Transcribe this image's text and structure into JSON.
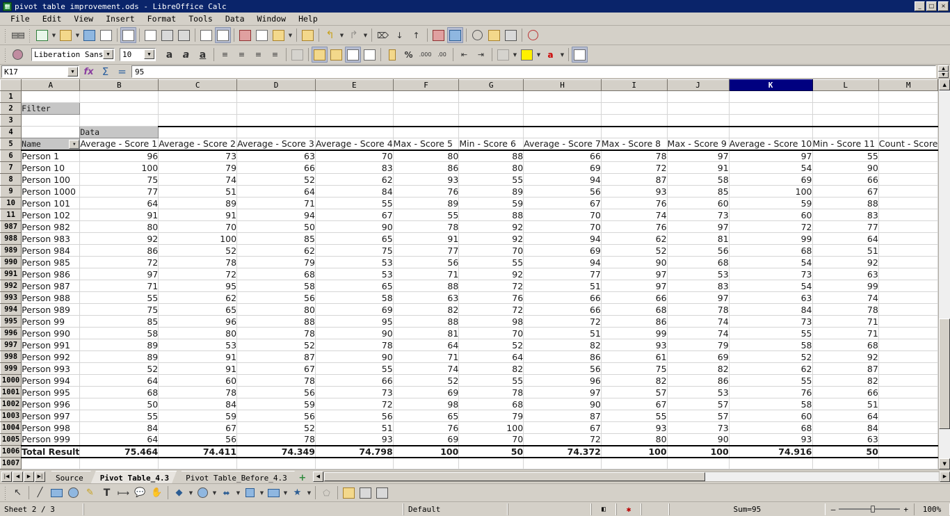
{
  "window": {
    "title": "pivot table improvement.ods - LibreOffice Calc",
    "minimize": "_",
    "maximize": "□",
    "close": "×"
  },
  "menu": [
    "File",
    "Edit",
    "View",
    "Insert",
    "Format",
    "Tools",
    "Data",
    "Window",
    "Help"
  ],
  "formatting": {
    "font_name": "Liberation Sans",
    "font_size": "10"
  },
  "formula_bar": {
    "name_box": "K17",
    "content": "95",
    "function_wizard": "fx",
    "sum": "Σ",
    "formula": "="
  },
  "sheet": {
    "columns": [
      "A",
      "B",
      "C",
      "D",
      "E",
      "F",
      "G",
      "H",
      "I",
      "J",
      "K",
      "L",
      "M"
    ],
    "selected_column": "K",
    "labels": {
      "filter": "Filter",
      "data": "Data",
      "name": "Name",
      "total_result": "Total Result"
    },
    "headers": [
      "Average - Score 1",
      "Average - Score 2",
      "Average - Score 3",
      "Average - Score 4",
      "Max - Score 5",
      "Min - Score 6",
      "Average - Score 7",
      "Max - Score 8",
      "Max - Score 9",
      "Average - Score 10",
      "Min - Score 11",
      "Count - Score"
    ],
    "rows": [
      {
        "n": "6",
        "name": "Person 1",
        "v": [
          96,
          73,
          63,
          70,
          80,
          88,
          66,
          78,
          97,
          97,
          55
        ]
      },
      {
        "n": "7",
        "name": "Person 10",
        "v": [
          100,
          79,
          66,
          83,
          86,
          80,
          69,
          72,
          91,
          54,
          90
        ]
      },
      {
        "n": "8",
        "name": "Person 100",
        "v": [
          75,
          74,
          52,
          62,
          93,
          55,
          94,
          87,
          58,
          69,
          66
        ]
      },
      {
        "n": "9",
        "name": "Person 1000",
        "v": [
          77,
          51,
          64,
          84,
          76,
          89,
          56,
          93,
          85,
          100,
          67
        ]
      },
      {
        "n": "10",
        "name": "Person 101",
        "v": [
          64,
          89,
          71,
          55,
          89,
          59,
          67,
          76,
          60,
          59,
          88
        ]
      },
      {
        "n": "11",
        "name": "Person 102",
        "v": [
          91,
          91,
          94,
          67,
          55,
          88,
          70,
          74,
          73,
          60,
          83
        ]
      },
      {
        "n": "987",
        "name": "Person 982",
        "v": [
          80,
          70,
          50,
          90,
          78,
          92,
          70,
          76,
          97,
          72,
          77
        ]
      },
      {
        "n": "988",
        "name": "Person 983",
        "v": [
          92,
          100,
          85,
          65,
          91,
          92,
          94,
          62,
          81,
          99,
          64
        ]
      },
      {
        "n": "989",
        "name": "Person 984",
        "v": [
          86,
          52,
          62,
          75,
          77,
          70,
          69,
          52,
          56,
          68,
          51
        ]
      },
      {
        "n": "990",
        "name": "Person 985",
        "v": [
          72,
          78,
          79,
          53,
          56,
          55,
          94,
          90,
          68,
          54,
          92
        ]
      },
      {
        "n": "991",
        "name": "Person 986",
        "v": [
          97,
          72,
          68,
          53,
          71,
          92,
          77,
          97,
          53,
          73,
          63
        ]
      },
      {
        "n": "992",
        "name": "Person 987",
        "v": [
          71,
          95,
          58,
          65,
          88,
          72,
          51,
          97,
          83,
          54,
          99
        ]
      },
      {
        "n": "993",
        "name": "Person 988",
        "v": [
          55,
          62,
          56,
          58,
          63,
          76,
          66,
          66,
          97,
          63,
          74
        ]
      },
      {
        "n": "994",
        "name": "Person 989",
        "v": [
          75,
          65,
          80,
          69,
          82,
          72,
          66,
          68,
          78,
          84,
          78
        ]
      },
      {
        "n": "995",
        "name": "Person 99",
        "v": [
          85,
          96,
          88,
          95,
          88,
          98,
          72,
          86,
          74,
          73,
          71
        ]
      },
      {
        "n": "996",
        "name": "Person 990",
        "v": [
          58,
          80,
          78,
          90,
          81,
          70,
          51,
          99,
          74,
          55,
          71
        ]
      },
      {
        "n": "997",
        "name": "Person 991",
        "v": [
          89,
          53,
          52,
          78,
          64,
          52,
          82,
          93,
          79,
          58,
          68
        ]
      },
      {
        "n": "998",
        "name": "Person 992",
        "v": [
          89,
          91,
          87,
          90,
          71,
          64,
          86,
          61,
          69,
          52,
          92
        ]
      },
      {
        "n": "999",
        "name": "Person 993",
        "v": [
          52,
          91,
          67,
          55,
          74,
          82,
          56,
          75,
          82,
          62,
          87
        ]
      },
      {
        "n": "1000",
        "name": "Person 994",
        "v": [
          64,
          60,
          78,
          66,
          52,
          55,
          96,
          82,
          86,
          55,
          82
        ]
      },
      {
        "n": "1001",
        "name": "Person 995",
        "v": [
          68,
          78,
          56,
          73,
          69,
          78,
          97,
          57,
          53,
          76,
          66
        ]
      },
      {
        "n": "1002",
        "name": "Person 996",
        "v": [
          50,
          84,
          59,
          72,
          98,
          68,
          90,
          67,
          57,
          58,
          51
        ]
      },
      {
        "n": "1003",
        "name": "Person 997",
        "v": [
          55,
          59,
          56,
          56,
          65,
          79,
          87,
          55,
          57,
          60,
          64
        ]
      },
      {
        "n": "1004",
        "name": "Person 998",
        "v": [
          84,
          67,
          52,
          51,
          76,
          100,
          67,
          93,
          73,
          68,
          84
        ]
      },
      {
        "n": "1005",
        "name": "Person 999",
        "v": [
          64,
          56,
          78,
          93,
          69,
          70,
          72,
          80,
          90,
          93,
          63
        ]
      }
    ],
    "total_row": {
      "n": "1006",
      "v": [
        "75.464",
        "74.411",
        "74.349",
        "74.798",
        "100",
        "50",
        "74.372",
        "100",
        "100",
        "74.916",
        "50"
      ]
    },
    "last_row": "1007"
  },
  "tabs": {
    "items": [
      {
        "label": "Source",
        "active": false
      },
      {
        "label": "Pivot Table_4.3",
        "active": true
      },
      {
        "label": "Pivot Table_Before_4.3",
        "active": false
      }
    ],
    "add": "+",
    "nav_first": "|◀",
    "nav_prev": "◀",
    "nav_next": "▶",
    "nav_last": "▶|"
  },
  "status": {
    "sheet_info": "Sheet 2 / 3",
    "page_style": "Default",
    "sum": "Sum=95",
    "zoom": "100%",
    "zoom_minus": "–",
    "zoom_plus": "+"
  }
}
